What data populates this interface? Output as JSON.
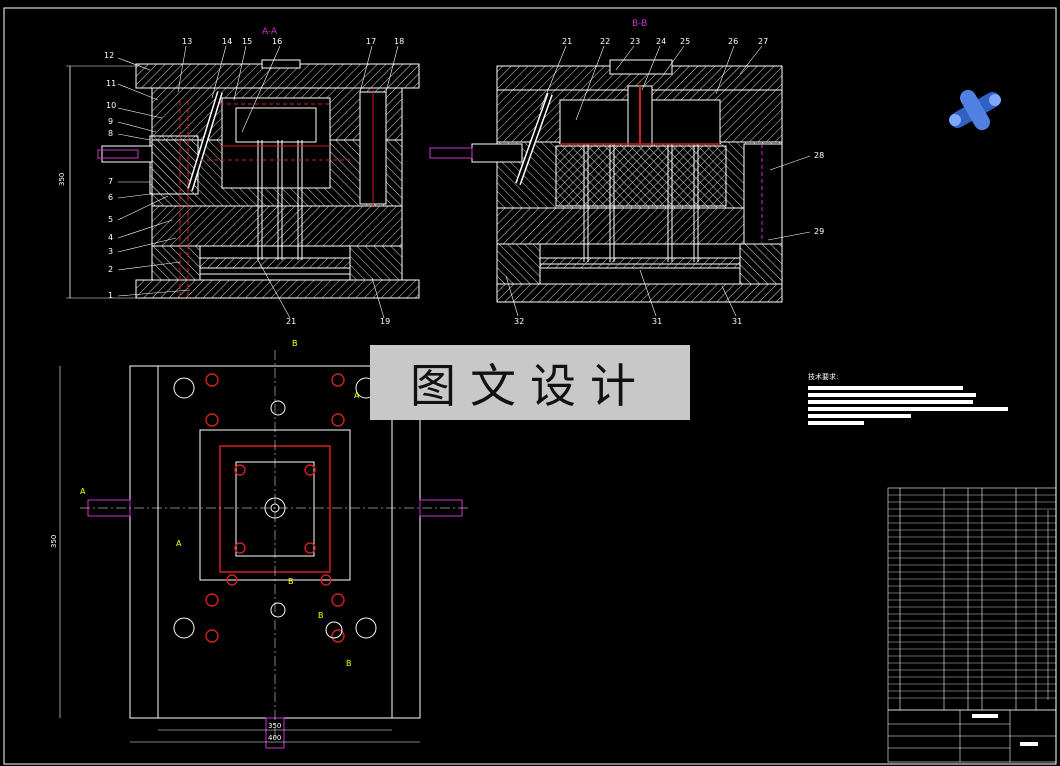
{
  "drawing": {
    "section_aa_label": "A-A",
    "section_bb_label": "B-B",
    "dim_height_label": "350",
    "dim_plan_height_label": "350",
    "dim_plan_width_inner": "350",
    "dim_plan_width_outer": "400",
    "left_callouts": [
      "12",
      "11",
      "10",
      "9",
      "8",
      "7",
      "6",
      "5",
      "4",
      "3",
      "2",
      "1"
    ],
    "left_top_callouts": [
      "13",
      "14",
      "15",
      "16",
      "17",
      "18"
    ],
    "left_bottom_callouts": [
      "21",
      "19"
    ],
    "right_top_callouts": [
      "21",
      "22",
      "23",
      "24",
      "25",
      "26",
      "27"
    ],
    "right_side_callouts": [
      "28",
      "29"
    ],
    "right_bottom_callouts": [
      "32",
      "31",
      "31"
    ],
    "plan_section_letters": [
      "B",
      "A",
      "A",
      "A",
      "B",
      "B",
      "B"
    ]
  },
  "watermark": {
    "text": "图文设计"
  },
  "tech_notes": {
    "title": "技术要求:"
  },
  "colors": {
    "line": "#ffffff",
    "hatch": "#ffffff",
    "section": "#cc33cc",
    "part_red": "#d02020",
    "dim": "#ffff00",
    "accent_blue": "#3060c0"
  }
}
